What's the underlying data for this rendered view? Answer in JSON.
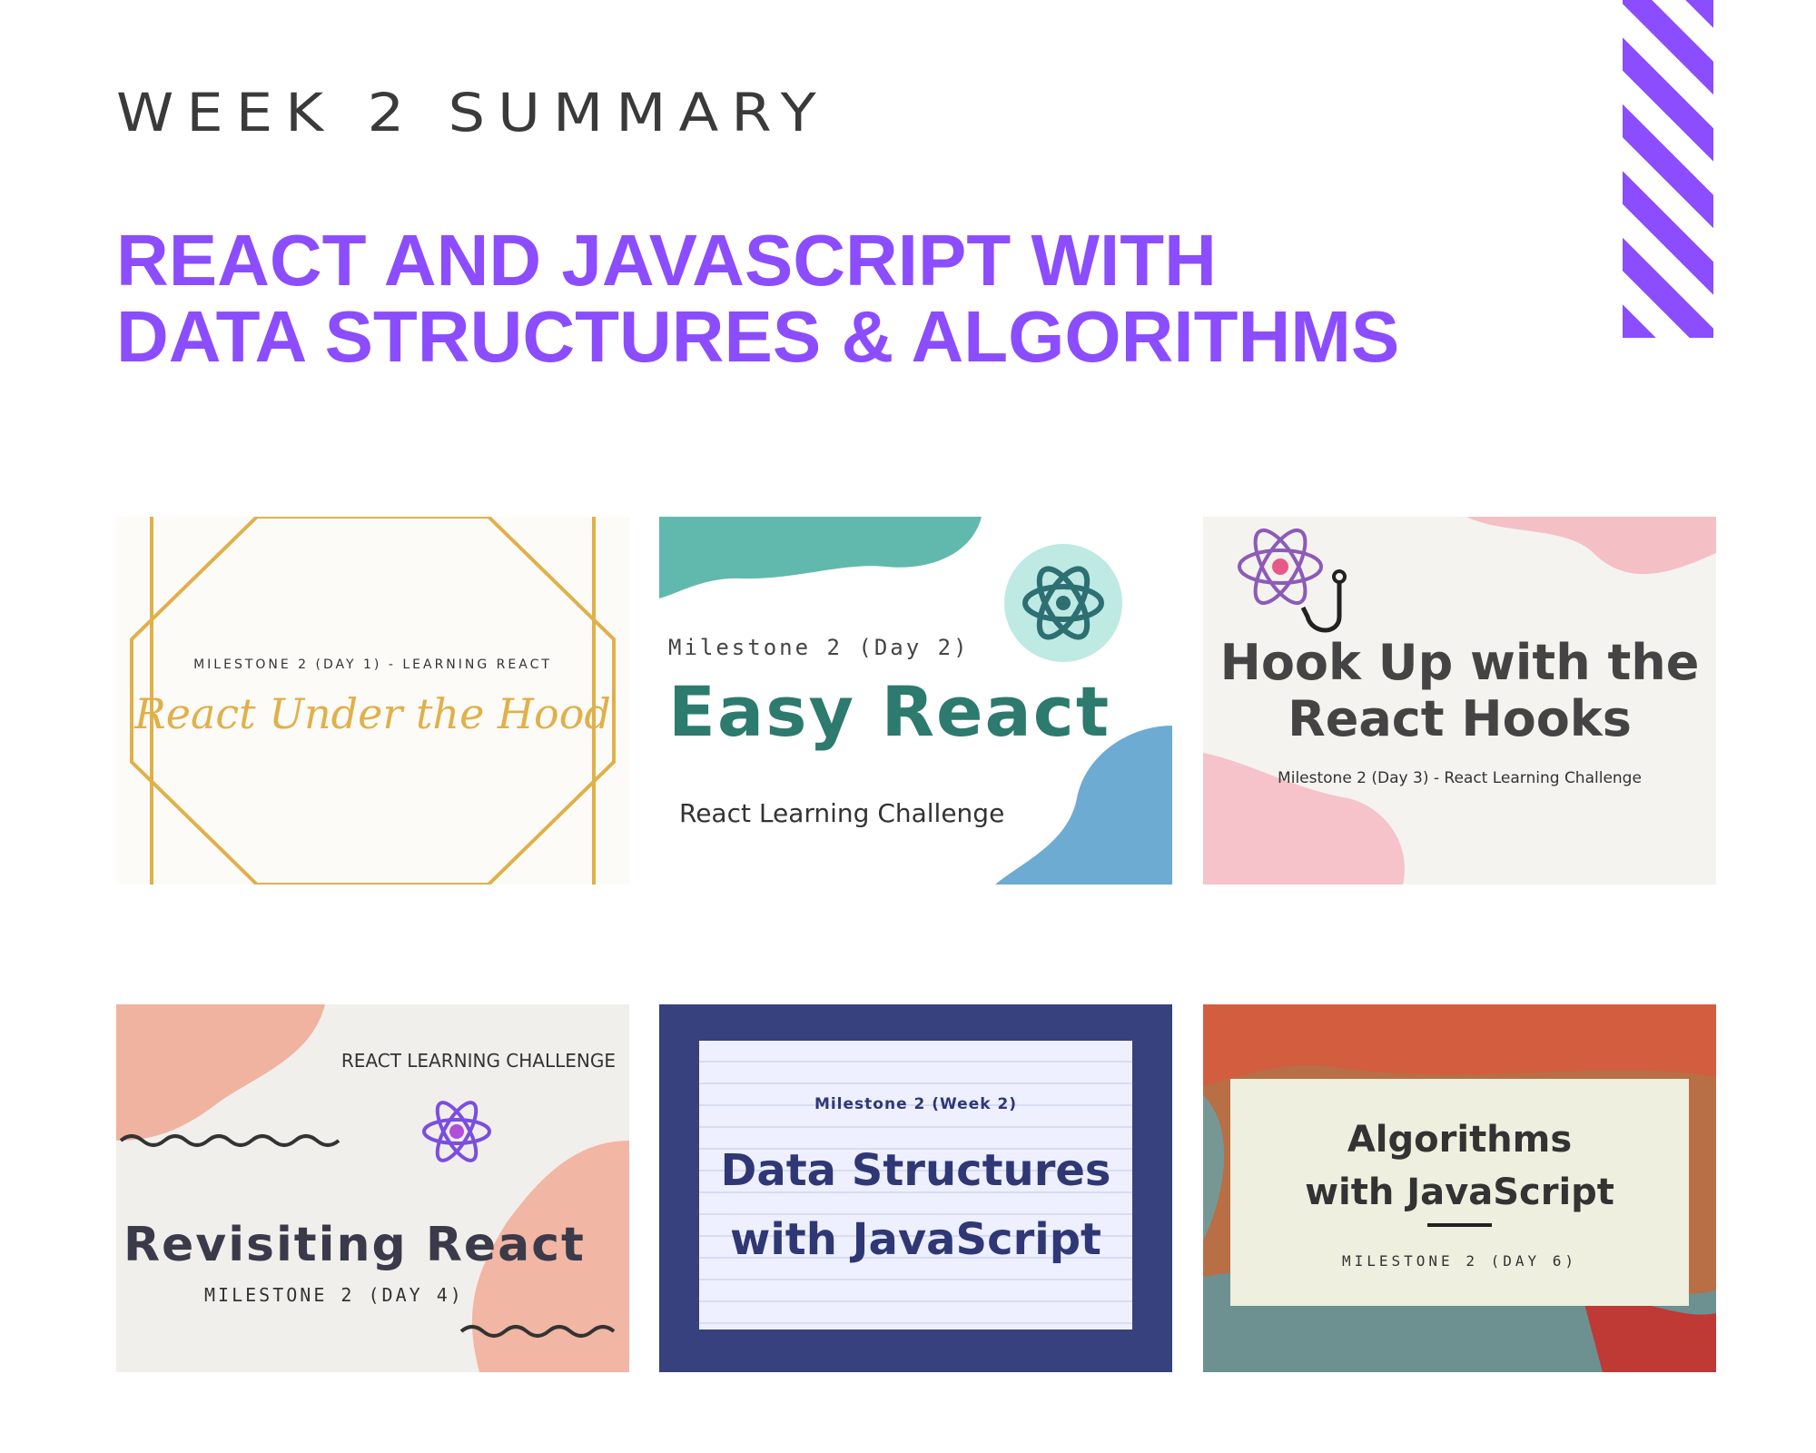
{
  "header": {
    "kicker": "WEEK 2 SUMMARY",
    "title_line1": "REACT AND JAVASCRIPT WITH",
    "title_line2": "DATA STRUCTURES & ALGORITHMS"
  },
  "colors": {
    "accent": "#8b4dff",
    "text": "#3a3a3a"
  },
  "cards": [
    {
      "subtitle": "MILESTONE 2 (DAY 1) - LEARNING REACT",
      "title": "React Under the Hood",
      "color": "#e0b04a"
    },
    {
      "subtitle": "Milestone 2 (Day 2)",
      "title": "Easy React",
      "footer": "React Learning Challenge",
      "color": "#2d7a6e"
    },
    {
      "title_line1": "Hook Up with the",
      "title_line2": "React Hooks",
      "subtitle": "Milestone 2 (Day 3) - React Learning Challenge",
      "icon": "react-hook-icon"
    },
    {
      "kicker": "REACT LEARNING CHALLENGE",
      "title": "Revisiting React",
      "subtitle": "MILESTONE 2 (DAY 4)",
      "icon": "react-atom-icon"
    },
    {
      "subtitle": "Milestone 2 (Week 2)",
      "title_line1": "Data Structures",
      "title_line2": "with JavaScript"
    },
    {
      "title_line1": "Algorithms",
      "title_line2": "with JavaScript",
      "subtitle": "MILESTONE 2 (DAY 6)"
    }
  ]
}
